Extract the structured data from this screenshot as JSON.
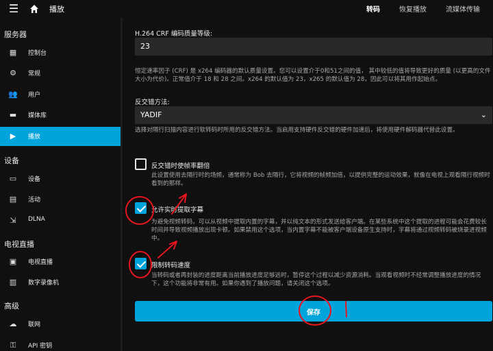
{
  "topbar": {
    "title": "播放",
    "tabs": [
      "转码",
      "恢复播放",
      "流媒体传输"
    ]
  },
  "sidebar": {
    "sections": [
      {
        "title": "服务器",
        "items": [
          {
            "label": "控制台",
            "icon": "dashboard-icon"
          },
          {
            "label": "常规",
            "icon": "gear-icon"
          },
          {
            "label": "用户",
            "icon": "users-icon"
          },
          {
            "label": "媒体库",
            "icon": "folder-icon"
          },
          {
            "label": "播放",
            "icon": "play-icon",
            "active": true
          }
        ]
      },
      {
        "title": "设备",
        "items": [
          {
            "label": "设备",
            "icon": "devices-icon"
          },
          {
            "label": "活动",
            "icon": "activity-icon"
          },
          {
            "label": "DLNA",
            "icon": "dlna-icon"
          }
        ]
      },
      {
        "title": "电视直播",
        "items": [
          {
            "label": "电视直播",
            "icon": "live-tv-icon"
          },
          {
            "label": "数字录像机",
            "icon": "dvr-icon"
          }
        ]
      },
      {
        "title": "高级",
        "items": [
          {
            "label": "联网",
            "icon": "cloud-icon"
          },
          {
            "label": "API 密钥",
            "icon": "key-icon"
          }
        ]
      }
    ]
  },
  "main": {
    "crf": {
      "label": "H.264 CRF 编码质量等级:",
      "value": "23",
      "help": "恒定速率因子 (CRF) 是 x264 编码器的默认质量设置。您可以设置介于0和51之间的值， 其中较低的值将导致更好的质量 (以更高的文件大小为代价)。正常值介于 18 和 28 之间。x264 的默认值为 23，x265 的默认值为 28，因此可以将其用作起始点。"
    },
    "deinterlace": {
      "label": "反交错方法:",
      "value": "YADIF",
      "help": "选择对隔行扫描内容进行软转码时所用的反交错方法。当启用支持硬件反交错的硬件加速后，将使用硬件解码器代替此设置。"
    },
    "double_rate": {
      "label": "反交错时使帧率翻倍",
      "help": "此设置使用去隔行时的场频，通常称为 Bob 去隔行，它将视频的帧频加倍，以提供完整的运动效果，就像在电视上观看隔行视频时看到的那样。",
      "checked": false
    },
    "extract_subs": {
      "label": "允许实时提取字幕",
      "help": "为避免视频转码，可以从视频中提取内置的字幕，并以纯文本的形式发送给客户端。在某些系统中这个提取的进程可能会花费较长时间并导致视频播放出现卡顿。如果禁用这个选项，当内置字幕不能被客户端设备原生支持时，字幕将通过视频转码被烧录进视频中。",
      "checked": true
    },
    "throttle": {
      "label": "限制转码速度",
      "help": "当转码或者再封装的进度距离当前播放进度足够远时，暂停这个过程以减少资源消耗。当观看视频时不经常调整播放进度的情况下，这个功能将非常有用。如果你遇到了播放问题，请关闭这个选项。",
      "checked": true
    },
    "save_label": "保存"
  },
  "colors": {
    "accent": "#00a4dc",
    "background": "#101010",
    "field": "#292929",
    "annotation": "#e8141e"
  }
}
